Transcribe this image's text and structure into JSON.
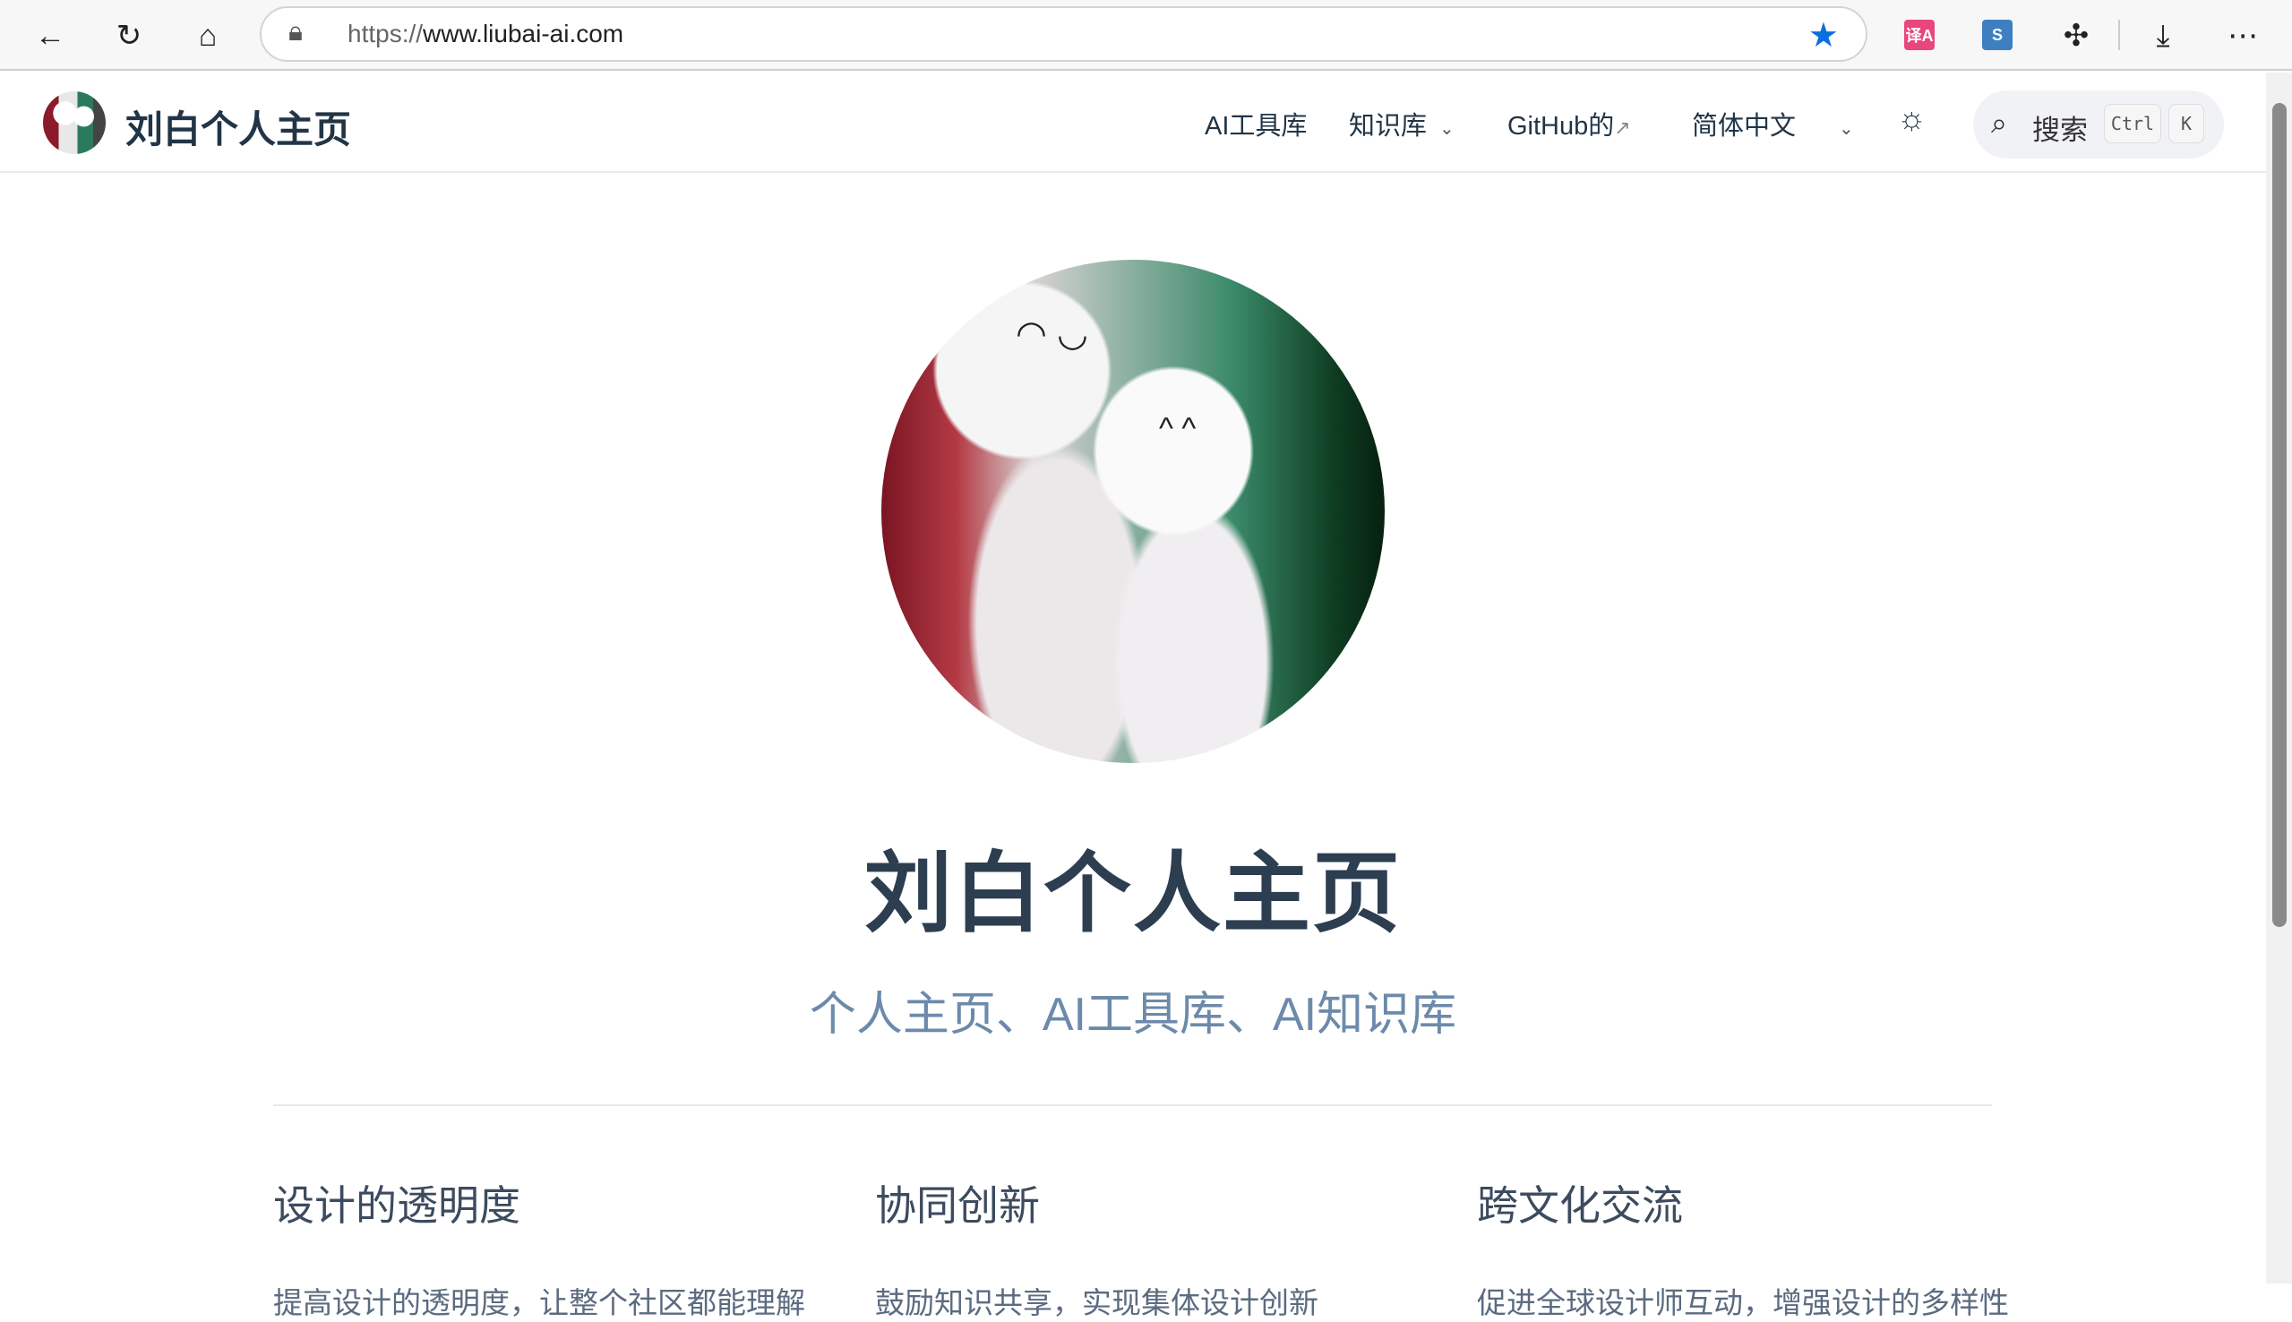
{
  "browser": {
    "url_prefix": "https://",
    "url_host": "www.liubai-ai.com",
    "ext_translate": "译A",
    "ext_s": "S"
  },
  "nav": {
    "brand": "刘白个人主页",
    "links": [
      "AI工具库",
      "知识库",
      "GitHub的",
      "简体中文"
    ],
    "search_label": "搜索",
    "kbd_ctrl": "Ctrl",
    "kbd_k": "K"
  },
  "hero": {
    "title": "刘白个人主页",
    "subtitle": "个人主页、AI工具库、AI知识库"
  },
  "features": [
    {
      "title": "设计的透明度",
      "desc": "提高设计的透明度，让整个社区都能理解"
    },
    {
      "title": "协同创新",
      "desc": "鼓励知识共享，实现集体设计创新"
    },
    {
      "title": "跨文化交流",
      "desc": "促进全球设计师互动，增强设计的多样性"
    }
  ]
}
